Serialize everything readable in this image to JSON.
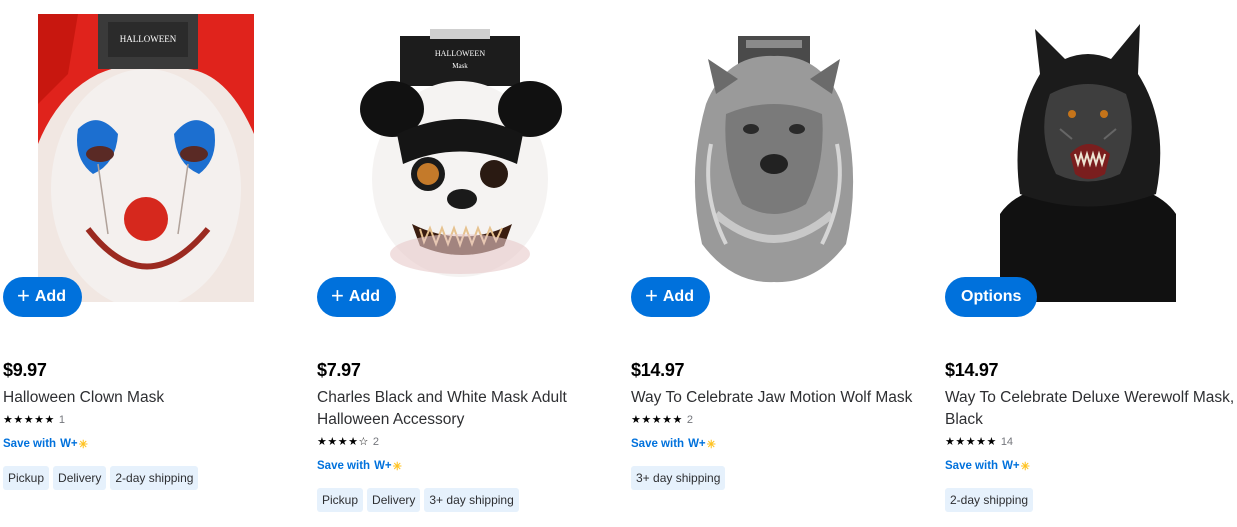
{
  "products": [
    {
      "image_alt": "Halloween Clown Mask",
      "button_label": "Add",
      "button_kind": "add",
      "price": "$9.97",
      "title": "Halloween Clown Mask",
      "stars": "★★★★★",
      "rating": 5,
      "review_count": "1",
      "save_with": "Save with",
      "save_brand": "W+",
      "tags": [
        "Pickup",
        "Delivery",
        "2-day shipping"
      ]
    },
    {
      "image_alt": "Charles Black and White Mask",
      "button_label": "Add",
      "button_kind": "add",
      "price": "$7.97",
      "title": "Charles Black and White Mask Adult Halloween Accessory",
      "stars": "★★★★☆",
      "rating": 4,
      "review_count": "2",
      "save_with": "Save with",
      "save_brand": "W+",
      "tags": [
        "Pickup",
        "Delivery",
        "3+ day shipping"
      ]
    },
    {
      "image_alt": "Jaw Motion Wolf Mask",
      "button_label": "Add",
      "button_kind": "add",
      "price": "$14.97",
      "title": "Way To Celebrate Jaw Motion Wolf Mask",
      "stars": "★★★★★",
      "rating": 5,
      "review_count": "2",
      "save_with": "Save with",
      "save_brand": "W+",
      "tags": [
        "3+ day shipping"
      ]
    },
    {
      "image_alt": "Deluxe Werewolf Mask",
      "button_label": "Options",
      "button_kind": "options",
      "price": "$14.97",
      "title": "Way To Celebrate Deluxe Werewolf Mask, Black",
      "stars": "★★★★★",
      "rating": 4.5,
      "review_count": "14",
      "save_with": "Save with",
      "save_brand": "W+",
      "tags": [
        "2-day shipping"
      ]
    }
  ],
  "colors": {
    "accent": "#0071dc",
    "tag_bg": "#e6f1fc",
    "spark": "#ffc220"
  }
}
